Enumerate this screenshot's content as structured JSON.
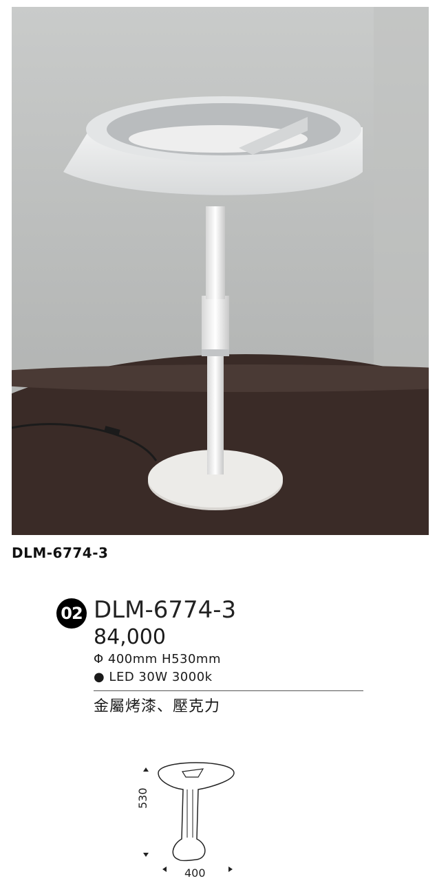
{
  "caption": "DLM-6774-3",
  "spec": {
    "badge": "02",
    "model": "DLM-6774-3",
    "price": "84,000",
    "dimensions": "Φ 400mm H530mm",
    "led": "● LED 30W 3000k",
    "material": "金屬烤漆、壓克力"
  },
  "diagram": {
    "height": "530",
    "width": "400"
  }
}
